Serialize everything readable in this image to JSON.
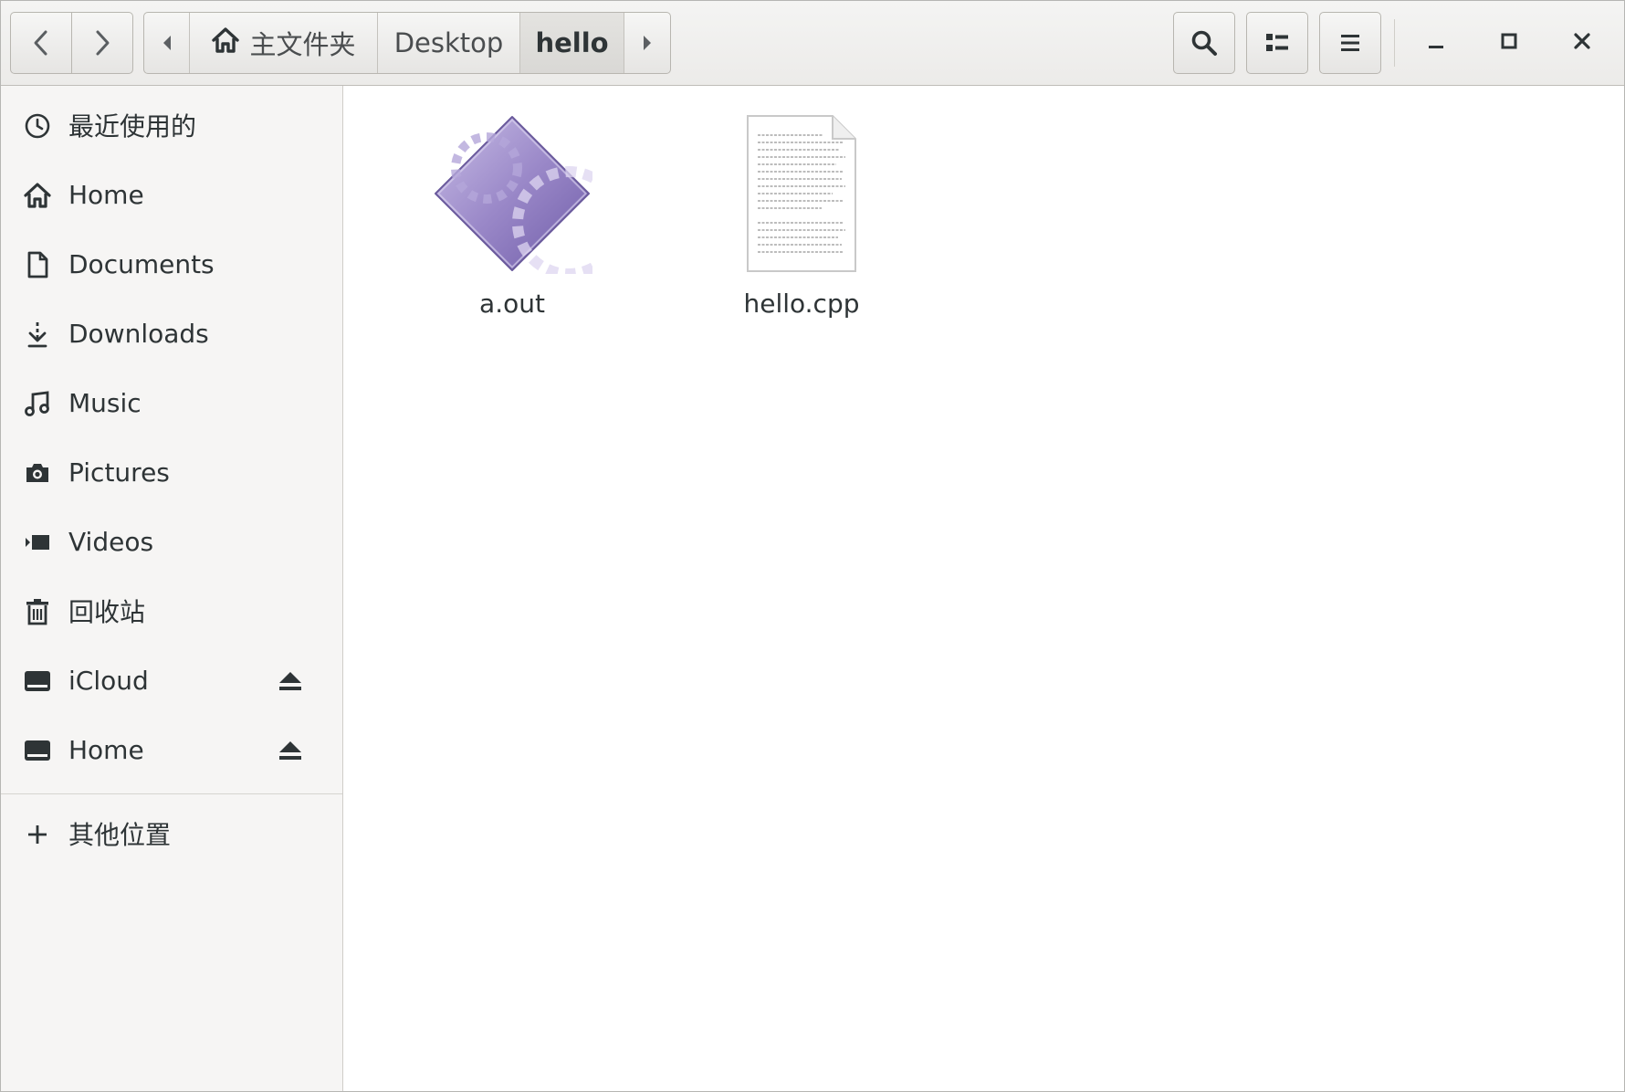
{
  "header": {
    "breadcrumbs": [
      "主文件夹",
      "Desktop",
      "hello"
    ],
    "icons": {
      "back": "chevron-left-icon",
      "forward": "chevron-right-icon",
      "search": "search-icon",
      "view": "list-view-icon",
      "menu": "hamburger-menu-icon",
      "minimize": "minimize-icon",
      "maximize": "maximize-icon",
      "close": "close-icon"
    }
  },
  "sidebar": {
    "items": [
      {
        "label": "最近使用的",
        "icon": "clock-icon"
      },
      {
        "label": "Home",
        "icon": "home-icon"
      },
      {
        "label": "Documents",
        "icon": "document-icon"
      },
      {
        "label": "Downloads",
        "icon": "download-icon"
      },
      {
        "label": "Music",
        "icon": "music-icon"
      },
      {
        "label": "Pictures",
        "icon": "camera-icon"
      },
      {
        "label": "Videos",
        "icon": "video-icon"
      },
      {
        "label": "回收站",
        "icon": "trash-icon"
      },
      {
        "label": "iCloud",
        "icon": "drive-icon"
      },
      {
        "label": "Home",
        "icon": "drive-icon"
      }
    ],
    "other_locations": "其他位置"
  },
  "files": [
    {
      "name": "a.out",
      "icon": "executable-icon"
    },
    {
      "name": "hello.cpp",
      "icon": "text-file-icon"
    }
  ],
  "colors": {
    "executable_icon": "#9a88c8",
    "accent": "#4a90d9"
  }
}
